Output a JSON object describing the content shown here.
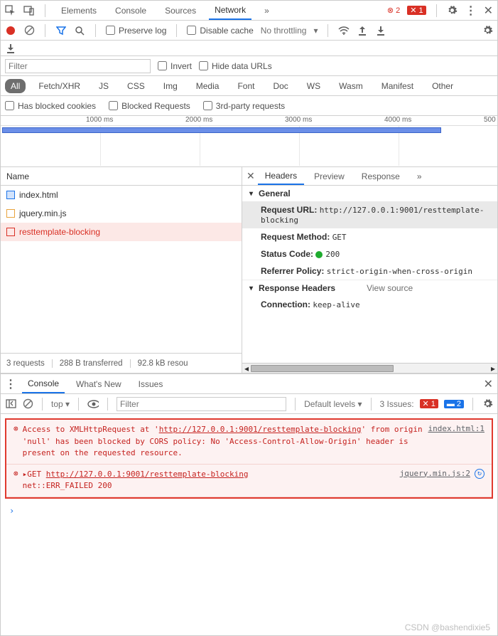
{
  "topTabs": {
    "elements": "Elements",
    "console": "Console",
    "sources": "Sources",
    "network": "Network",
    "more": "»"
  },
  "topBadges": {
    "errCircle": "2",
    "errSolid": "1"
  },
  "netBar": {
    "preserve": "Preserve log",
    "disable": "Disable cache",
    "throttle": "No throttling"
  },
  "filter": {
    "placeholder": "Filter",
    "invert": "Invert",
    "hide": "Hide data URLs"
  },
  "typePills": [
    "All",
    "Fetch/XHR",
    "JS",
    "CSS",
    "Img",
    "Media",
    "Font",
    "Doc",
    "WS",
    "Wasm",
    "Manifest",
    "Other"
  ],
  "typeChecks": {
    "blockedCookies": "Has blocked cookies",
    "blockedReq": "Blocked Requests",
    "thirdParty": "3rd-party requests"
  },
  "timeline": {
    "t1": "1000 ms",
    "t2": "2000 ms",
    "t3": "3000 ms",
    "t4": "4000 ms",
    "t5": "500"
  },
  "nameCol": "Name",
  "requests": [
    {
      "name": "index.html",
      "color": "#1a73e8",
      "bg": "#d2e3fc"
    },
    {
      "name": "jquery.min.js",
      "color": "#e8a33d",
      "bg": "#fff"
    },
    {
      "name": "resttemplate-blocking",
      "color": "#d93025",
      "bg": "#fff"
    }
  ],
  "summary": {
    "count": "3 requests",
    "xfer": "288 B transferred",
    "res": "92.8 kB resou"
  },
  "detailTabs": {
    "headers": "Headers",
    "preview": "Preview",
    "response": "Response",
    "more": "»"
  },
  "sections": {
    "general": "General",
    "reqUrlK": "Request URL:",
    "reqUrlV": "http://127.0.0.1:9001/resttemplate-blocking",
    "methodK": "Request Method:",
    "methodV": "GET",
    "statusK": "Status Code:",
    "statusV": "200",
    "refK": "Referrer Policy:",
    "refV": "strict-origin-when-cross-origin",
    "respHdr": "Response Headers",
    "viewSrc": "View source",
    "connK": "Connection:",
    "connV": "keep-alive"
  },
  "drawerTabs": {
    "console": "Console",
    "whatsnew": "What's New",
    "issues": "Issues"
  },
  "consoleBar": {
    "top": "top",
    "filterPh": "Filter",
    "levels": "Default levels",
    "issues": "3 Issues:",
    "b1": "1",
    "b2": "2"
  },
  "msgs": {
    "m1": "Access to XMLHttpRequest at '<a>http://127.0.0.1:9001/resttemplate-blocking</a>' from origin 'null' has been blocked by CORS policy: No 'Access-Control-Allow-Origin' header is present on the requested resource.",
    "m1src": "index.html:1",
    "m2a": "GET ",
    "m2b": "http://127.0.0.1:9001/resttemplate-blocking",
    "m2c": " net::ERR_FAILED 200",
    "m2src": "jquery.min.js:2"
  },
  "watermark": "CSDN @bashendixie5"
}
